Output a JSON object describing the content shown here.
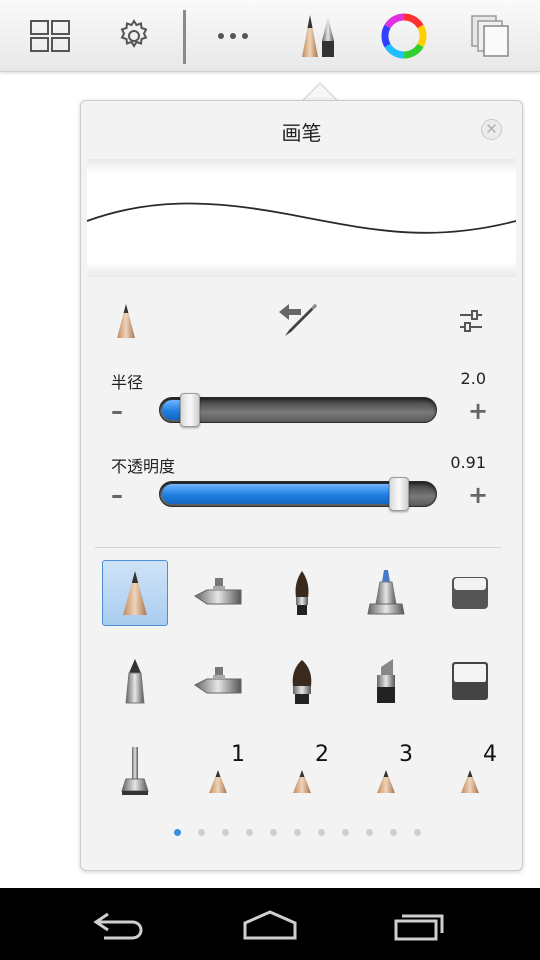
{
  "toolbar": {
    "items": [
      {
        "name": "gallery-grid"
      },
      {
        "name": "settings"
      },
      {
        "name": "more"
      },
      {
        "name": "brushes"
      },
      {
        "name": "color-wheel"
      },
      {
        "name": "layers"
      }
    ],
    "accent": "#3a8ee0"
  },
  "panel": {
    "title": "画笔",
    "close_icon": "close-icon"
  },
  "sliders": {
    "radius": {
      "label": "半径",
      "value_text": "2.0",
      "fraction": 0.08
    },
    "opacity": {
      "label": "不透明度",
      "value_text": "0.91",
      "fraction": 0.9
    }
  },
  "signs": {
    "minus": "–",
    "plus": "+"
  },
  "brush_library": {
    "selected": "pencil",
    "rows": [
      [
        "pencil",
        "airbrush",
        "paint-brush",
        "marker",
        "eraser"
      ],
      [
        "ballpoint-pen",
        "airbrush-2",
        "paint-brush-2",
        "chisel-marker",
        "eraser-hard"
      ],
      [
        "smudge-stamp",
        "custom-slot-1",
        "custom-slot-2",
        "custom-slot-3",
        "custom-slot-4"
      ]
    ],
    "slot_numbers": [
      "1",
      "2",
      "3",
      "4"
    ],
    "pages": 11,
    "current_page": 1
  },
  "navbar": {
    "buttons": [
      "back",
      "home",
      "recent-apps"
    ]
  }
}
